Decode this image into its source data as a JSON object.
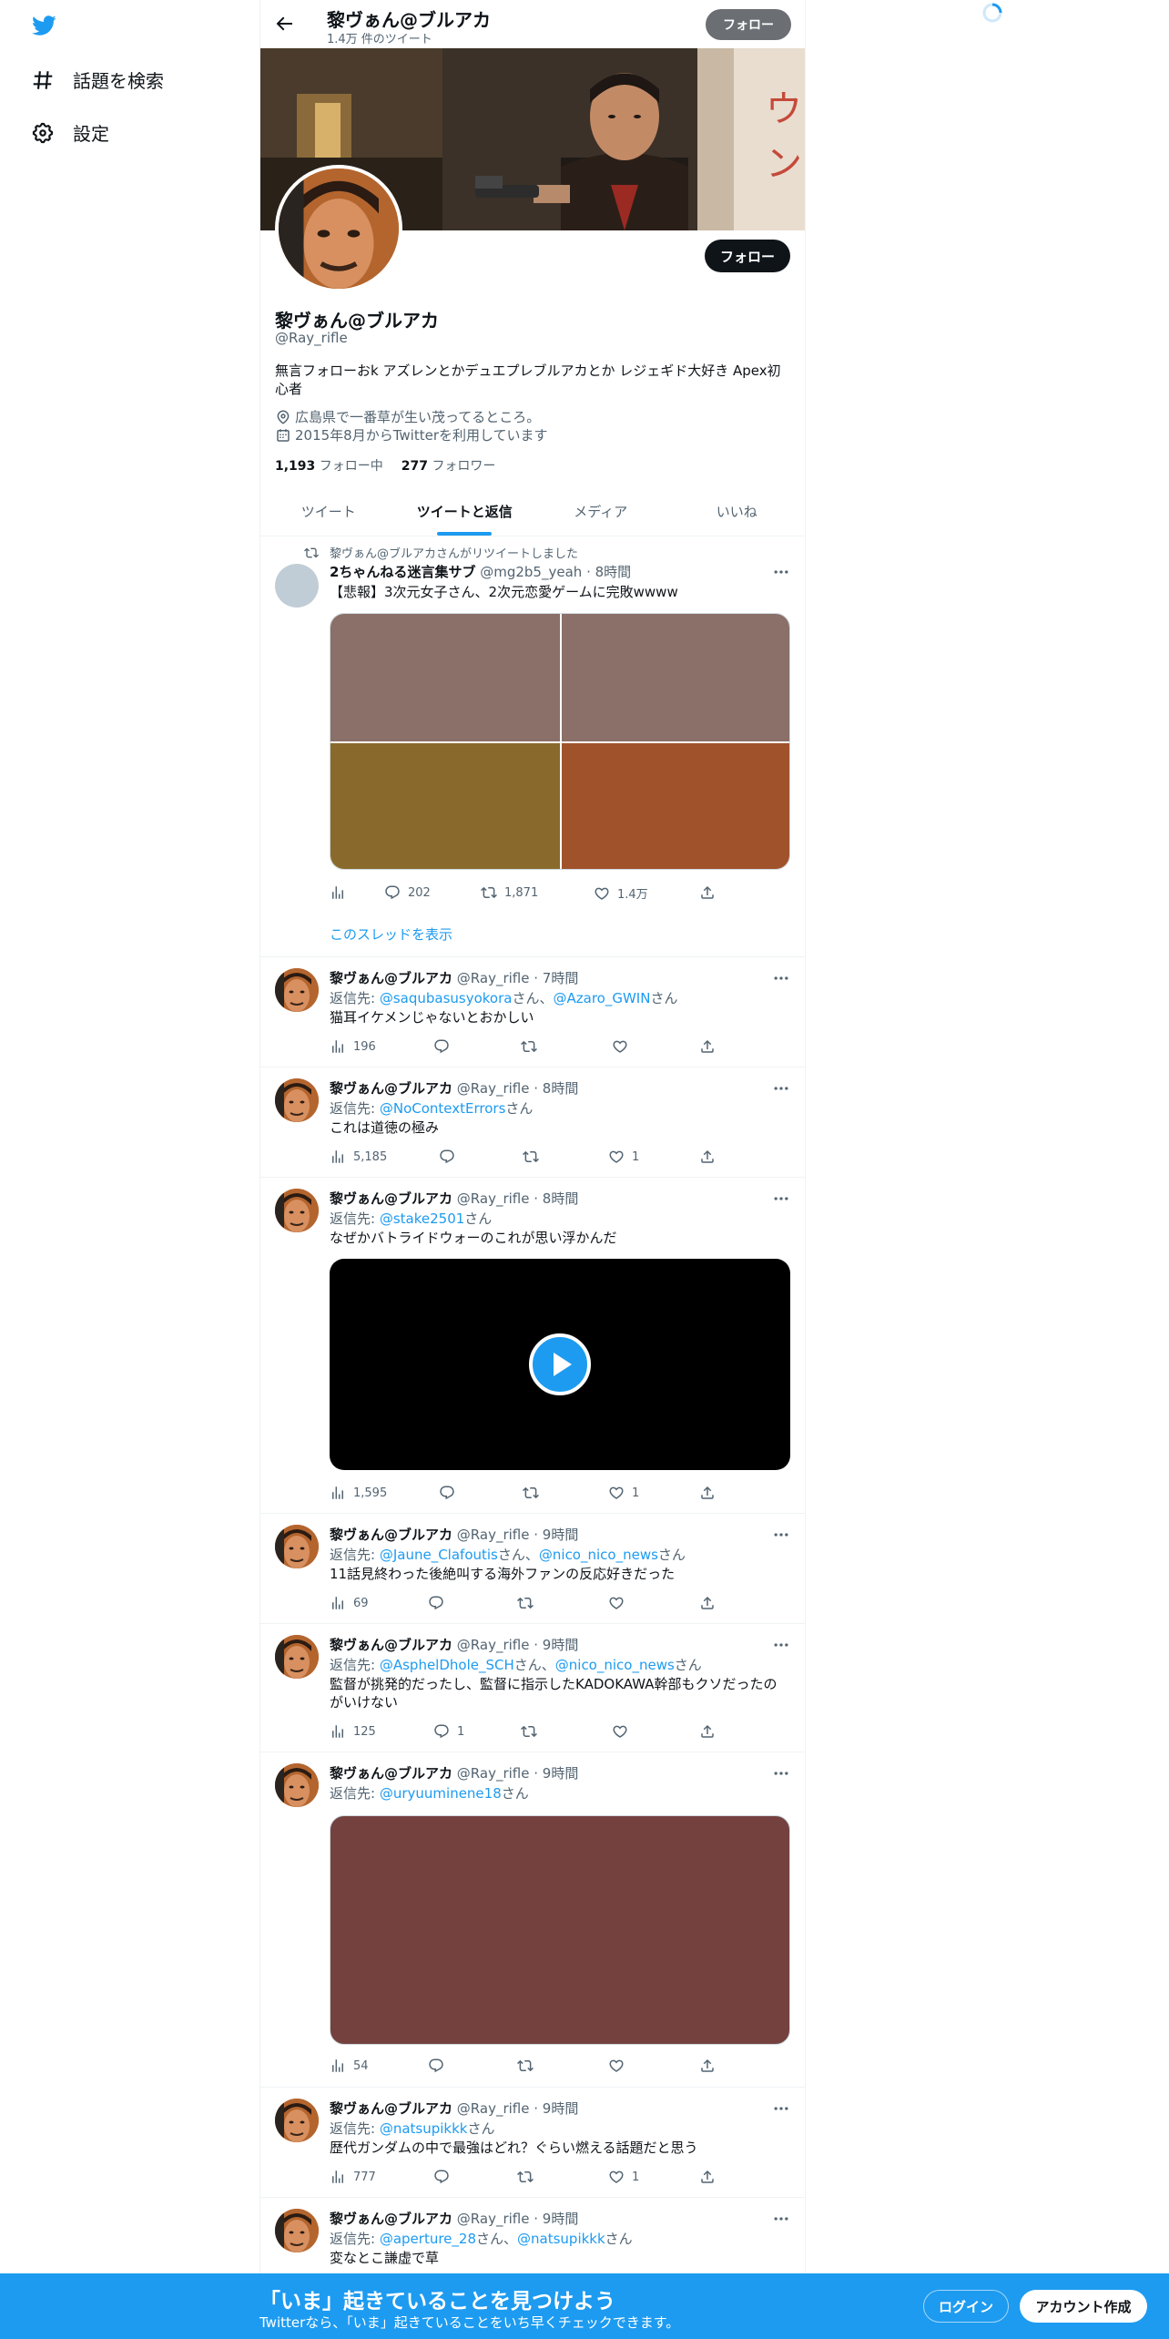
{
  "nav": {
    "items": [
      {
        "label": "話題を検索",
        "icon": "hashtag-icon"
      },
      {
        "label": "設定",
        "icon": "gear-icon"
      }
    ]
  },
  "header": {
    "title": "黎ヴぁん@ブルアカ",
    "subtitle": "1.4万 件のツイート",
    "follow_label": "フォロー"
  },
  "profile": {
    "name": "黎ヴぁん@ブルアカ",
    "handle": "@Ray_rifle",
    "bio": "無言フォローおk アズレンとかデュエプレブルアカとか レジェギド大好き Apex初心者",
    "location": "広島県で一番草が生い茂ってるところ。",
    "joined": "2015年8月からTwitterを利用しています",
    "following_count": "1,193",
    "following_label": "フォロー中",
    "followers_count": "277",
    "followers_label": "フォロワー",
    "follow_label": "フォロー"
  },
  "tabs": [
    {
      "label": "ツイート",
      "active": false
    },
    {
      "label": "ツイートと返信",
      "active": true
    },
    {
      "label": "メディア",
      "active": false
    },
    {
      "label": "いいね",
      "active": false
    }
  ],
  "retweet_note": "黎ヴぁん@ブルアカさんがリツイートしました",
  "tweets": [
    {
      "name": "2ちゃんねる迷言集サブ",
      "handle": "@mg2b5_yeah",
      "time": "· 8時間",
      "text": "【悲報】3次元女子さん、2次元恋愛ゲームに完敗wwww",
      "views": "",
      "replies": "202",
      "retweets": "1,871",
      "likes": "1.4万",
      "thread_link": "このスレッドを表示"
    },
    {
      "name": "黎ヴぁん@ブルアカ",
      "handle": "@Ray_rifle",
      "time": "· 7時間",
      "reply_prefix": "返信先:",
      "reply_to": "@saqubasusyokora",
      "reply_sep": "さん、",
      "reply_to2": "@Azaro_GWIN",
      "reply_suffix": "さん",
      "text": "猫耳イケメンじゃないとおかしい",
      "views": "196",
      "replies": "",
      "retweets": "",
      "likes": ""
    },
    {
      "name": "黎ヴぁん@ブルアカ",
      "handle": "@Ray_rifle",
      "time": "· 8時間",
      "reply_prefix": "返信先:",
      "reply_to": "@NoContextErrors",
      "reply_suffix": "さん",
      "text": "これは道徳の極み",
      "views": "5,185",
      "replies": "",
      "retweets": "",
      "likes": "1"
    },
    {
      "name": "黎ヴぁん@ブルアカ",
      "handle": "@Ray_rifle",
      "time": "· 8時間",
      "reply_prefix": "返信先:",
      "reply_to": "@stake2501",
      "reply_suffix": "さん",
      "text": "なぜかバトライドウォーのこれが思い浮かんだ",
      "views": "1,595",
      "replies": "",
      "retweets": "",
      "likes": "1"
    },
    {
      "name": "黎ヴぁん@ブルアカ",
      "handle": "@Ray_rifle",
      "time": "· 9時間",
      "reply_prefix": "返信先:",
      "reply_to": "@Jaune_Clafoutis",
      "reply_sep": "さん、",
      "reply_to2": "@nico_nico_news",
      "reply_suffix": "さん",
      "text": "11話見終わった後絶叫する海外ファンの反応好きだった",
      "views": "69",
      "replies": "",
      "retweets": "",
      "likes": ""
    },
    {
      "name": "黎ヴぁん@ブルアカ",
      "handle": "@Ray_rifle",
      "time": "· 9時間",
      "reply_prefix": "返信先:",
      "reply_to": "@AsphelDhole_SCH",
      "reply_sep": "さん、",
      "reply_to2": "@nico_nico_news",
      "reply_suffix": "さん",
      "text": "監督が挑発的だったし、監督に指示したKADOKAWA幹部もクソだったのがいけない",
      "views": "125",
      "replies": "1",
      "retweets": "",
      "likes": ""
    },
    {
      "name": "黎ヴぁん@ブルアカ",
      "handle": "@Ray_rifle",
      "time": "· 9時間",
      "reply_prefix": "返信先:",
      "reply_to": "@uryuuminene18",
      "reply_suffix": "さん",
      "text": "",
      "views": "54",
      "replies": "",
      "retweets": "",
      "likes": ""
    },
    {
      "name": "黎ヴぁん@ブルアカ",
      "handle": "@Ray_rifle",
      "time": "· 9時間",
      "reply_prefix": "返信先:",
      "reply_to": "@natsupikkk",
      "reply_suffix": "さん",
      "text": "歴代ガンダムの中で最強はどれ？ぐらい燃える話題だと思う",
      "views": "777",
      "replies": "",
      "retweets": "",
      "likes": "1"
    },
    {
      "name": "黎ヴぁん@ブルアカ",
      "handle": "@Ray_rifle",
      "time": "· 9時間",
      "reply_prefix": "返信先:",
      "reply_to": "@aperture_28",
      "reply_sep": "さん、",
      "reply_to2": "@natsupikkk",
      "reply_suffix": "さん",
      "text": "変なとこ謙虚で草"
    }
  ],
  "media_colors": {
    "grid": [
      "#8a7068",
      "#8a7068",
      "#8a6a2c",
      "#a0522a"
    ],
    "single": "#74413f"
  },
  "bottom_bar": {
    "title": "「いま」起きていることを見つけよう",
    "subtitle": "Twitterなら、「いま」起きていることをいち早くチェックできます。",
    "login_label": "ログイン",
    "signup_label": "アカウント作成"
  },
  "colors": {
    "accent": "#1d9bf0",
    "text": "#0f1419",
    "muted": "#536471"
  }
}
